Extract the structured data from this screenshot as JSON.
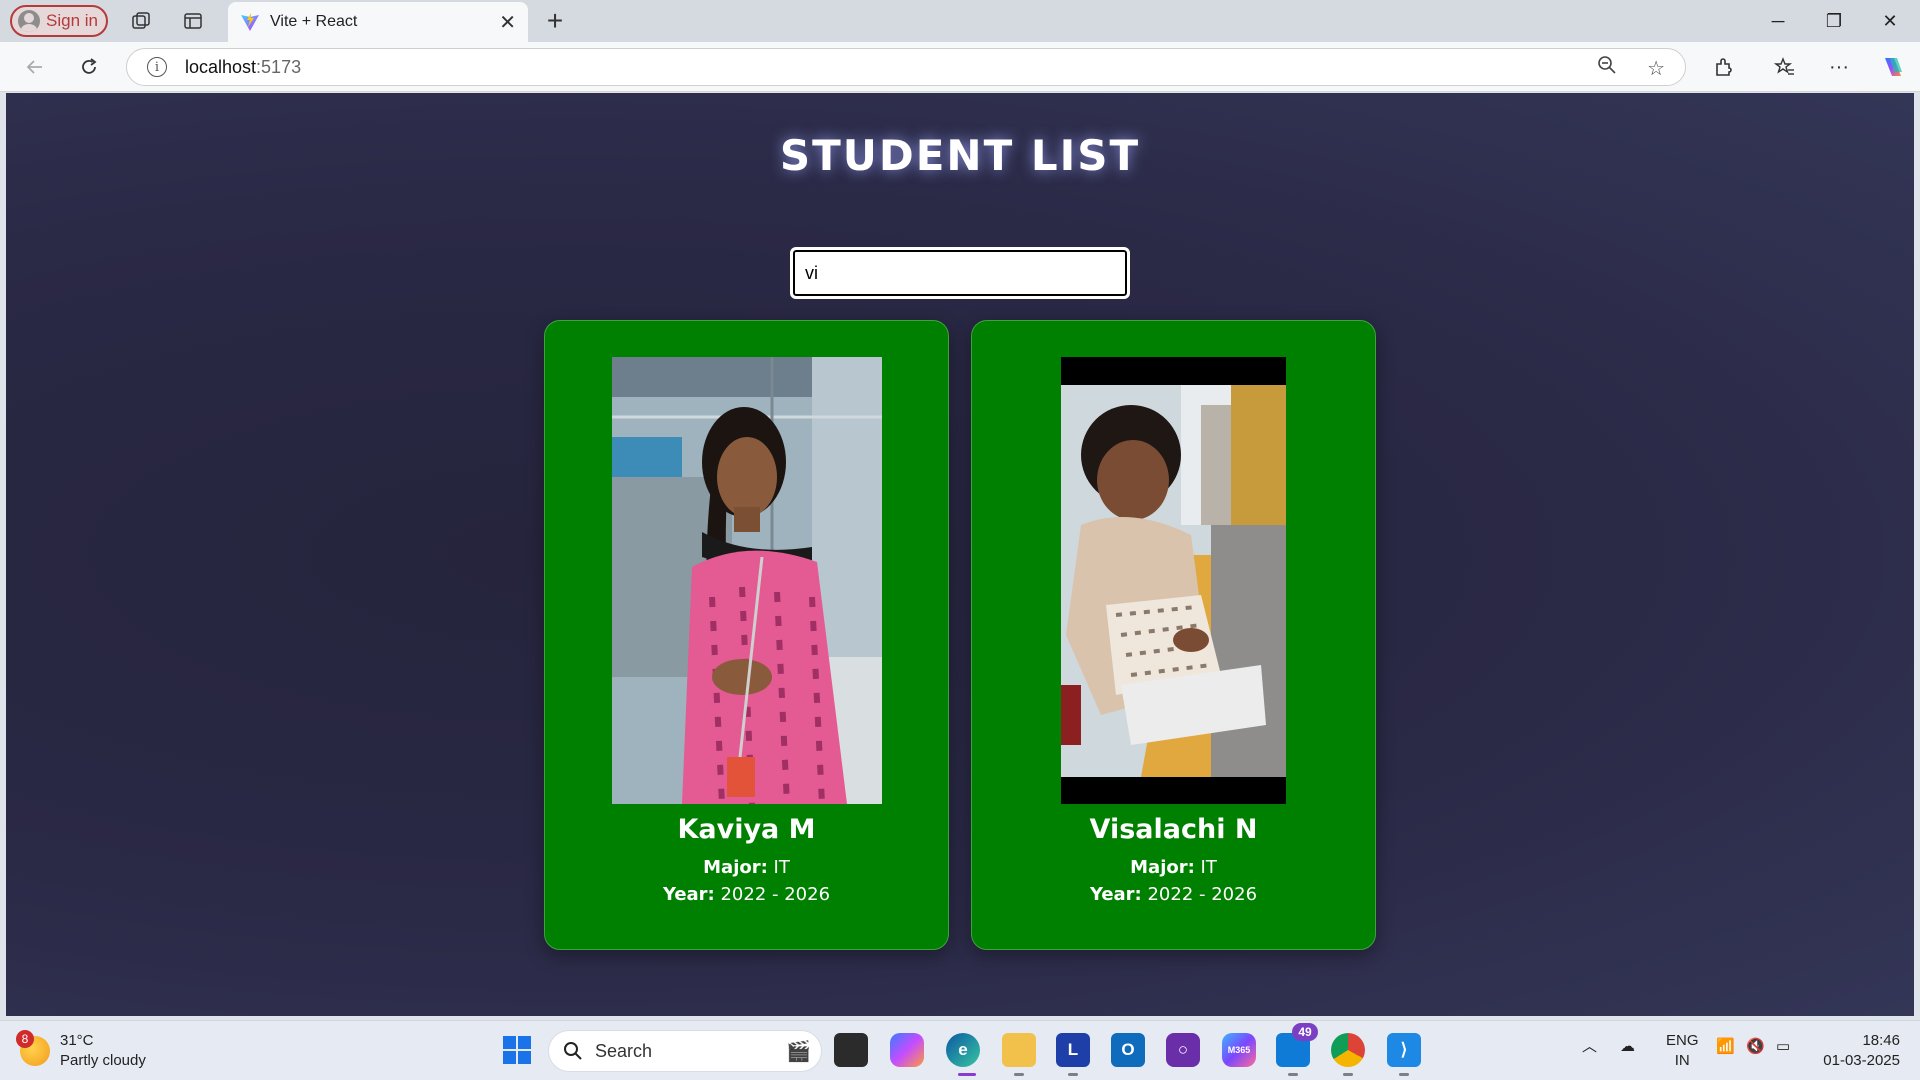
{
  "browser": {
    "signin_label": "Sign in",
    "tab_title": "Vite + React",
    "url_host": "localhost",
    "url_port": ":5173"
  },
  "page": {
    "title": "STUDENT LIST",
    "search_value": "vi"
  },
  "students": [
    {
      "name": "Kaviya M",
      "major_label": "Major:",
      "major": "IT",
      "year_label": "Year:",
      "year": "2022 - 2026"
    },
    {
      "name": "Visalachi N",
      "major_label": "Major:",
      "major": "IT",
      "year_label": "Year:",
      "year": "2022 - 2026"
    }
  ],
  "taskbar": {
    "weather_badge": "8",
    "temperature": "31°C",
    "condition": "Partly cloudy",
    "search_label": "Search",
    "teams_badge": "49",
    "lang_line1": "ENG",
    "lang_line2": "IN",
    "time": "18:46",
    "date": "01-03-2025"
  },
  "colors": {
    "card_bg": "#008000",
    "page_bg": "#2a2946",
    "title_glow": "#a0aaff"
  }
}
